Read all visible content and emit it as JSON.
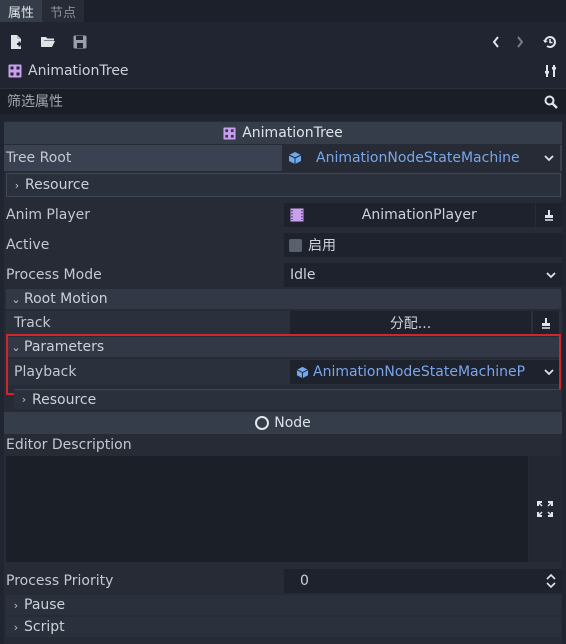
{
  "tabs": [
    {
      "label": "属性",
      "active": true
    },
    {
      "label": "节点",
      "active": false
    }
  ],
  "toolbar": {
    "icons": [
      "new-script-icon",
      "folder-open-icon",
      "save-icon",
      "history-back-icon",
      "history-forward-icon",
      "object-history-icon"
    ]
  },
  "object": {
    "name": "AnimationTree",
    "icon": "animation-tree-icon"
  },
  "filter": {
    "placeholder": "筛选属性",
    "value": ""
  },
  "inspector": {
    "section_title": "AnimationTree",
    "tree_root": {
      "label": "Tree Root",
      "value": "AnimationNodeStateMachine"
    },
    "tree_root_resource": {
      "label": "Resource"
    },
    "anim_player": {
      "label": "Anim Player",
      "value": "AnimationPlayer"
    },
    "active": {
      "label": "Active",
      "checkbox_label": "启用",
      "checked": false
    },
    "process_mode": {
      "label": "Process Mode",
      "value": "Idle"
    },
    "root_motion": {
      "label": "Root Motion",
      "track_label": "Track",
      "track_value": "分配..."
    },
    "parameters": {
      "label": "Parameters",
      "playback_label": "Playback",
      "playback_value": "AnimationNodeStateMachinePl",
      "resource_label": "Resource"
    },
    "node_section": {
      "title": "Node"
    },
    "editor_description": {
      "label": "Editor Description",
      "value": ""
    },
    "process_priority": {
      "label": "Process Priority",
      "value": "0"
    },
    "pause": {
      "label": "Pause"
    },
    "script": {
      "label": "Script"
    }
  },
  "colors": {
    "accent_link": "#7aa6ea",
    "highlight_border": "#d0262b",
    "background": "#202531"
  }
}
